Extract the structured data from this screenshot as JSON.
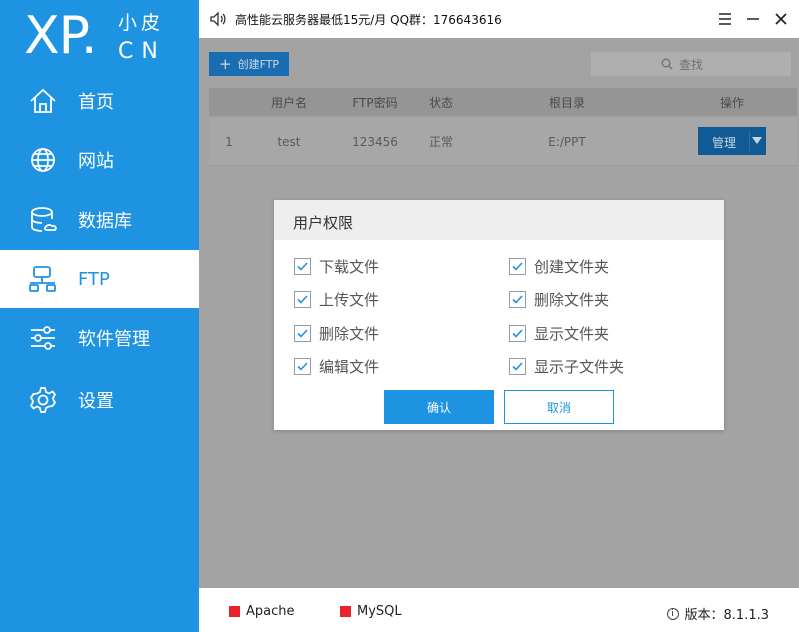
{
  "logo": {
    "main": "XP.",
    "top": "小皮",
    "bottom": "CN"
  },
  "nav": [
    {
      "label": "首页",
      "icon": "home-icon"
    },
    {
      "label": "网站",
      "icon": "globe-icon"
    },
    {
      "label": "数据库",
      "icon": "database-icon"
    },
    {
      "label": "FTP",
      "icon": "ftp-network-icon",
      "active": true
    },
    {
      "label": "软件管理",
      "icon": "sliders-icon"
    },
    {
      "label": "设置",
      "icon": "gear-icon"
    }
  ],
  "topbar": {
    "notice": "高性能云服务器最低15元/月   QQ群：176643616"
  },
  "toolbar": {
    "create_label": "创建FTP",
    "search_placeholder": "查找"
  },
  "table": {
    "columns": [
      "",
      "用户名",
      "FTP密码",
      "状态",
      "根目录",
      "操作"
    ],
    "rows": [
      {
        "index": "1",
        "username": "test",
        "password": "123456",
        "status": "正常",
        "root": "E:/PPT",
        "action": "管理"
      }
    ]
  },
  "modal": {
    "title": "用户权限",
    "permissions_left": [
      "下载文件",
      "上传文件",
      "删除文件",
      "编辑文件"
    ],
    "permissions_right": [
      "创建文件夹",
      "删除文件夹",
      "显示文件夹",
      "显示子文件夹"
    ],
    "confirm_label": "确认",
    "cancel_label": "取消"
  },
  "status": {
    "services": [
      {
        "name": "Apache",
        "color": "#e8232a"
      },
      {
        "name": "MySQL",
        "color": "#e8232a"
      }
    ],
    "version_label": "版本：8.1.1.3"
  },
  "colors": {
    "accent": "#1e93e2",
    "overlay": "#a3a3a3"
  }
}
